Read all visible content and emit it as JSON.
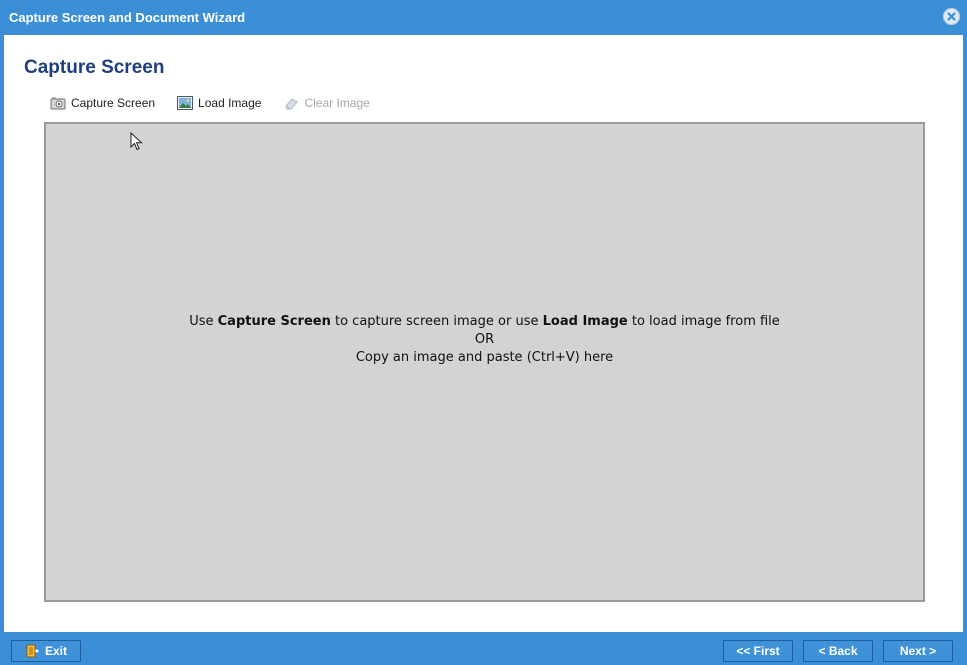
{
  "window": {
    "title": "Capture Screen and Document Wizard",
    "close_icon": "close-icon"
  },
  "page": {
    "title": "Capture Screen"
  },
  "toolbar": {
    "capture_label": "Capture Screen",
    "capture_icon": "camera-icon",
    "load_label": "Load Image",
    "load_icon": "image-icon",
    "clear_label": "Clear Image",
    "clear_icon": "eraser-icon"
  },
  "canvas": {
    "hint_use": "Use",
    "hint_capture": "Capture Screen",
    "hint_mid": "to capture screen image or use",
    "hint_load": "Load Image",
    "hint_end": "to load image from file",
    "hint_or": "OR",
    "hint_paste": "Copy an image and paste (Ctrl+V) here"
  },
  "footer": {
    "exit_label": "Exit",
    "exit_icon": "exit-door-icon",
    "first_label": "<< First",
    "back_label": "< Back",
    "next_label": "Next >"
  },
  "colors": {
    "accent": "#3a8fd6",
    "title_text": "#1f3f7f",
    "canvas_bg": "#d3d3d3"
  }
}
